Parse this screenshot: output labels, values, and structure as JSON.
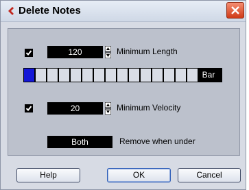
{
  "window": {
    "title": "Delete Notes",
    "icon": "cubase-logo-icon"
  },
  "min_length": {
    "checked": true,
    "value": "120",
    "label": "Minimum Length"
  },
  "length_grid": {
    "unit_label": "Bar"
  },
  "min_velocity": {
    "checked": true,
    "value": "20",
    "label": "Minimum Velocity"
  },
  "remove": {
    "value": "Both",
    "label": "Remove when under"
  },
  "buttons": {
    "help": "Help",
    "ok": "OK",
    "cancel": "Cancel"
  },
  "colors": {
    "active_cell": "#1417d6",
    "panel": "#bcc1cc",
    "field": "#000000"
  }
}
